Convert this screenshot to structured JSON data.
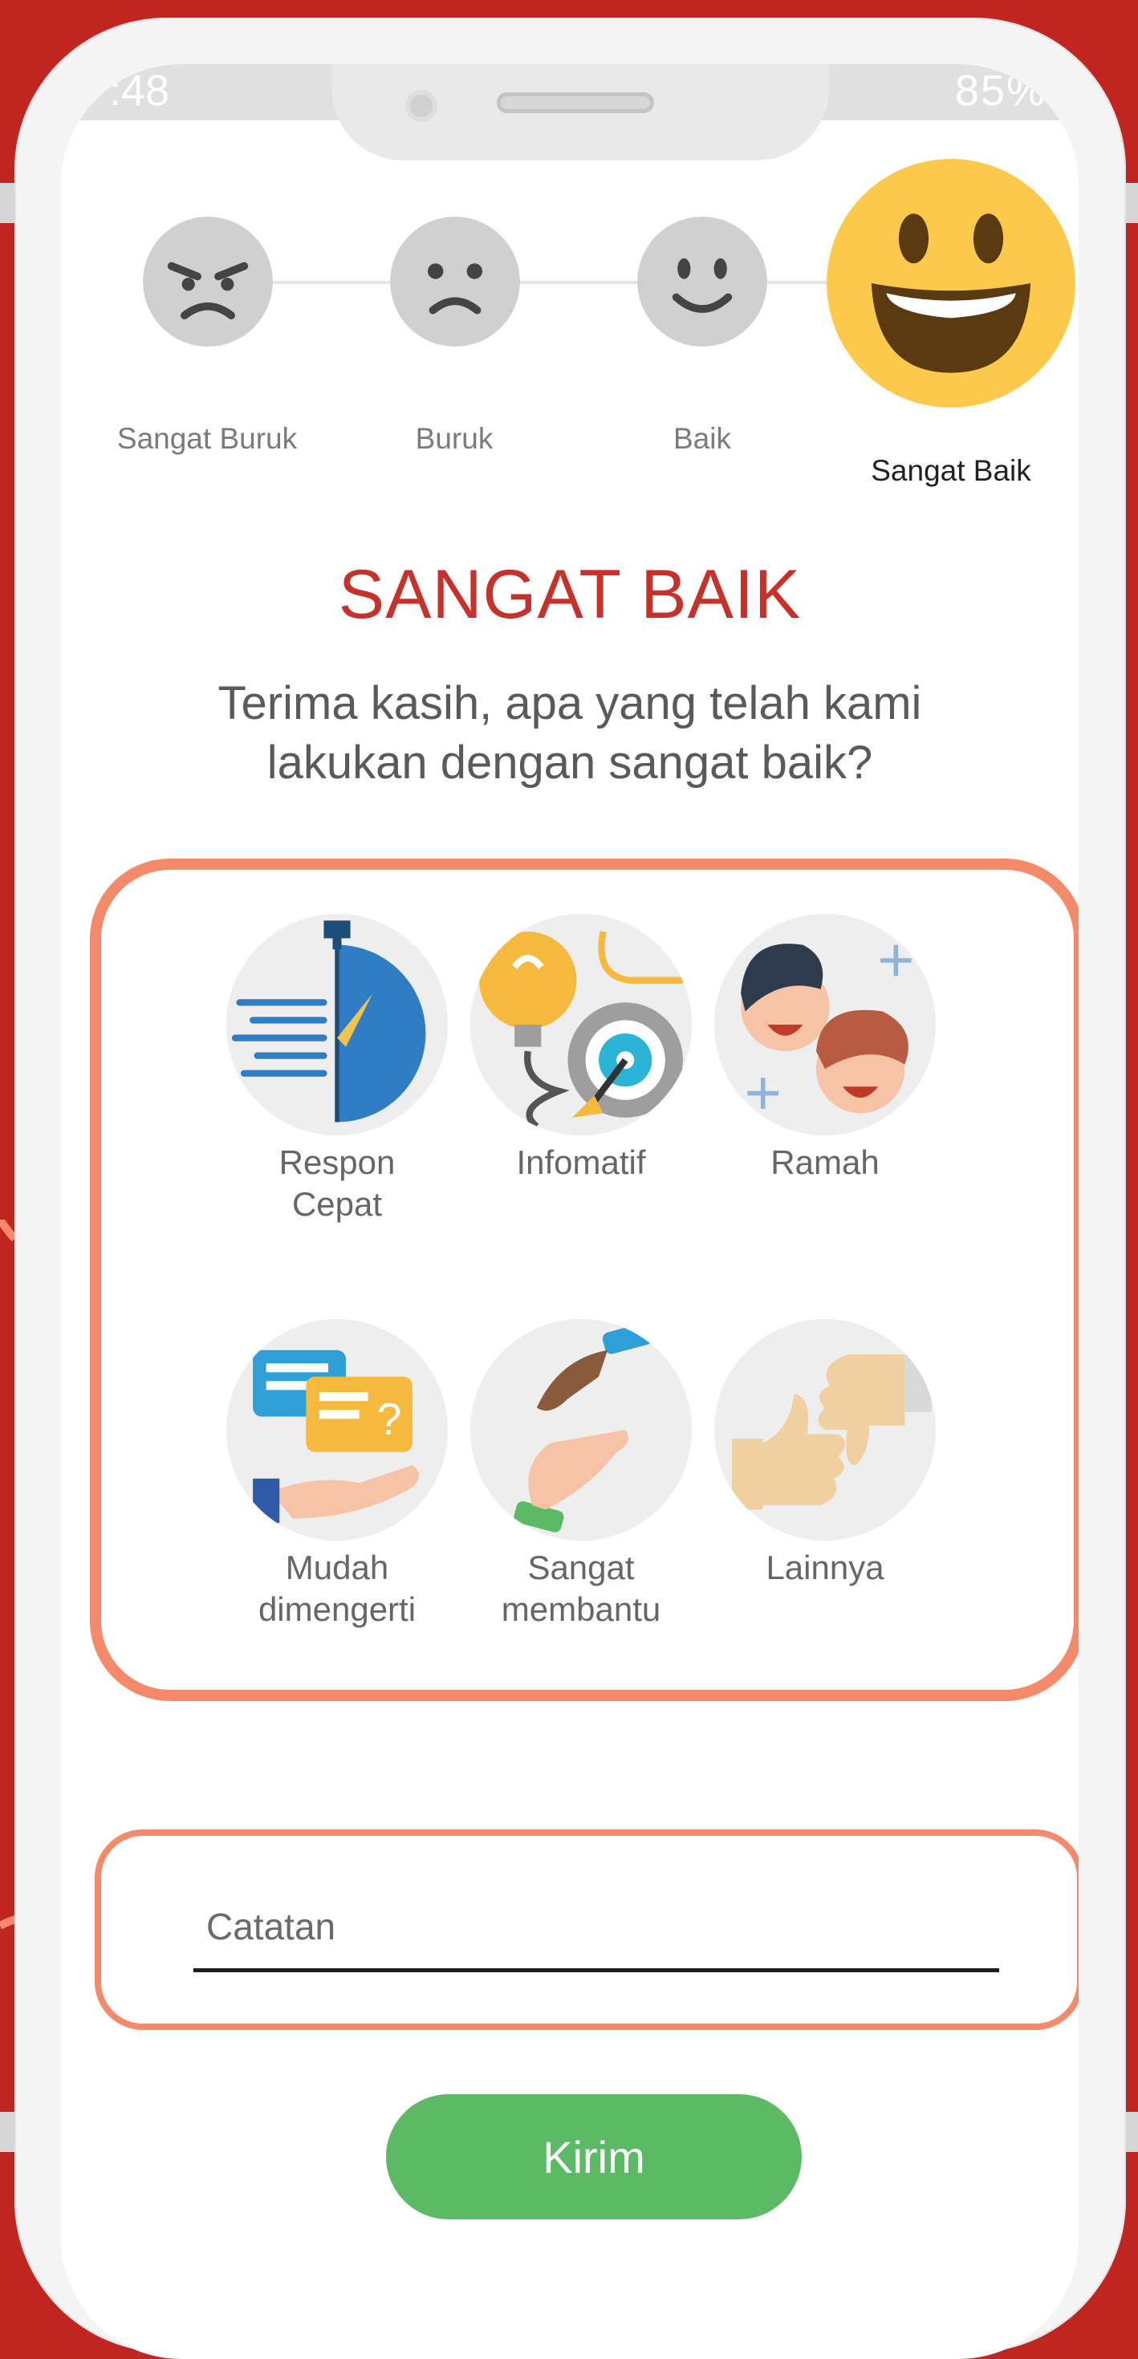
{
  "status_bar": {
    "time": ":48",
    "right": "85%"
  },
  "ratings": [
    {
      "label": "Sangat Buruk",
      "icon": "angry-face-icon"
    },
    {
      "label": "Buruk",
      "icon": "frowning-face-icon"
    },
    {
      "label": "Baik",
      "icon": "smiling-face-icon"
    },
    {
      "label": "Sangat Baik",
      "icon": "grinning-face-icon",
      "selected": true
    }
  ],
  "heading": "SANGAT BAIK",
  "subheading": "Terima kasih, apa yang telah kami lakukan dengan sangat baik?",
  "options": [
    {
      "label": "Respon\nCepat",
      "icon": "stopwatch-icon"
    },
    {
      "label": "Infomatif",
      "icon": "lightbulb-target-icon"
    },
    {
      "label": "Ramah",
      "icon": "smiling-people-icon"
    },
    {
      "label": "Mudah\ndimengerti",
      "icon": "chat-bubbles-hand-icon"
    },
    {
      "label": "Sangat\nmembantu",
      "icon": "helping-hands-icon"
    },
    {
      "label": "Lainnya",
      "icon": "thumbs-up-down-icon"
    }
  ],
  "notes": {
    "placeholder": "Catatan",
    "value": ""
  },
  "submit_label": "Kirim",
  "colors": {
    "background": "#c0251f",
    "heading": "#c8302a",
    "card_border": "#f48a6a",
    "submit": "#5cba65",
    "face_inactive": "#d0d0d0",
    "face_active": "#fcc94a"
  }
}
